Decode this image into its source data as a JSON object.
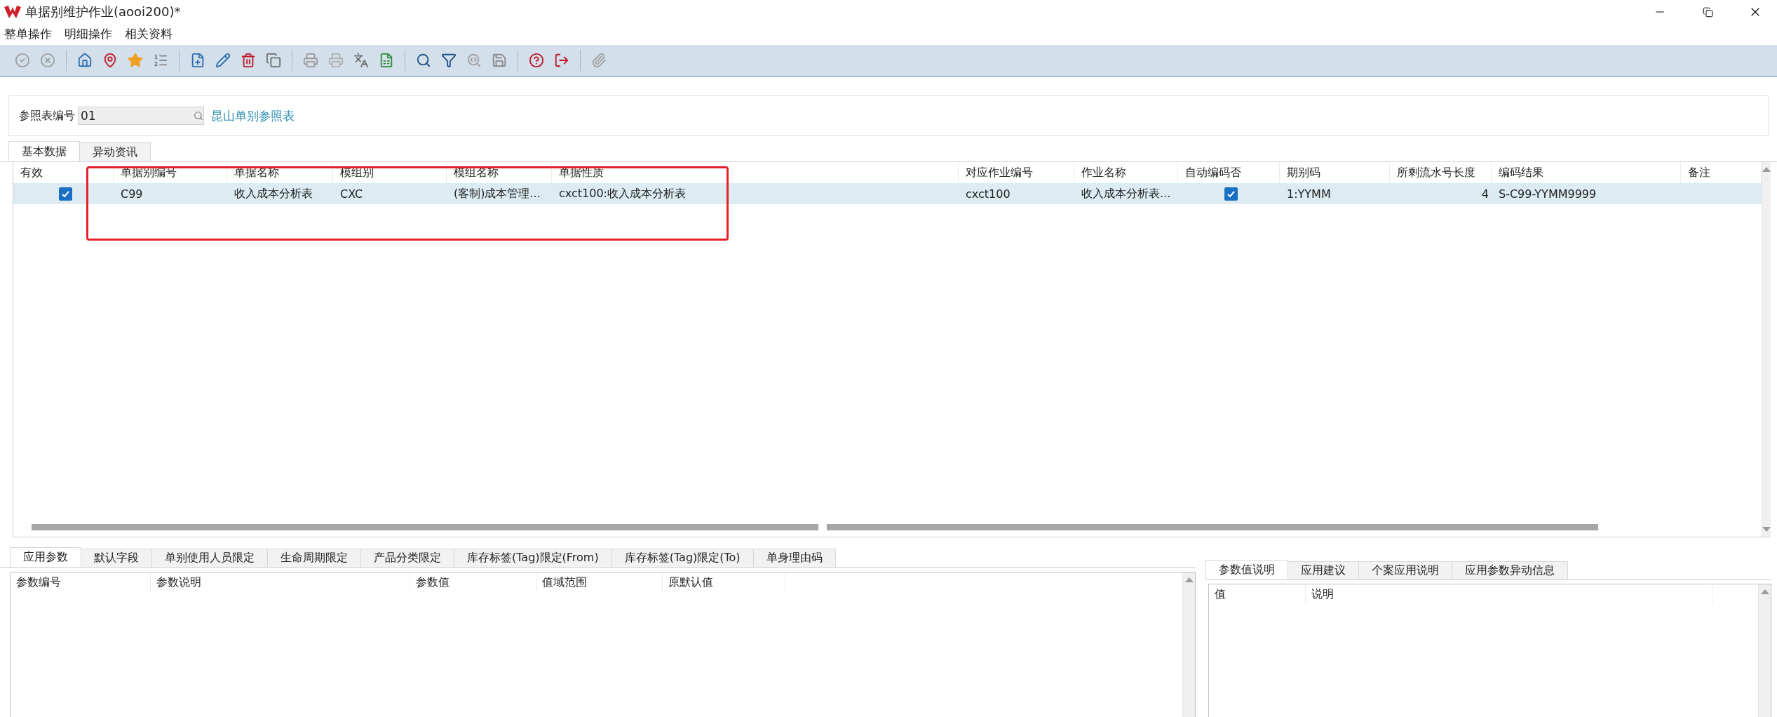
{
  "window": {
    "title": "单据别维护作业(aooi200)*"
  },
  "menu": [
    "整单操作",
    "明细操作",
    "相关资料"
  ],
  "header_form": {
    "label": "参照表编号",
    "value": "01",
    "link": "昆山单别参照表"
  },
  "top_tabs": [
    {
      "label": "基本数据",
      "selected": true
    },
    {
      "label": "异动资讯",
      "selected": false
    }
  ],
  "table": {
    "columns": [
      {
        "label": "有效",
        "kind": "check"
      },
      {
        "label": "单据别编号",
        "kind": "text"
      },
      {
        "label": "单据名称",
        "kind": "text"
      },
      {
        "label": "模组别",
        "kind": "text"
      },
      {
        "label": "模组名称",
        "kind": "text"
      },
      {
        "label": "单据性质",
        "kind": "text"
      },
      {
        "label": "对应作业编号",
        "kind": "text"
      },
      {
        "label": "作业名称",
        "kind": "text"
      },
      {
        "label": "自动编码否",
        "kind": "check"
      },
      {
        "label": "期别码",
        "kind": "text"
      },
      {
        "label": "所剩流水号长度",
        "kind": "number"
      },
      {
        "label": "编码结果",
        "kind": "text"
      },
      {
        "label": "备注",
        "kind": "text"
      }
    ],
    "rows": [
      {
        "selected": true,
        "cells": [
          {
            "checked": true
          },
          {
            "text": "C99"
          },
          {
            "text": "收入成本分析表"
          },
          {
            "text": "CXC"
          },
          {
            "text": "(客制)成本管理..."
          },
          {
            "text": "cxct100:收入成本分析表"
          },
          {
            "text": "cxct100"
          },
          {
            "text": "收入成本分析表..."
          },
          {
            "checked": true
          },
          {
            "text": "1:YYMM"
          },
          {
            "text": "4"
          },
          {
            "text": "S-C99-YYMM9999"
          },
          {}
        ]
      }
    ]
  },
  "bottom_tabs": [
    {
      "label": "应用参数",
      "selected": true
    },
    {
      "label": "默认字段",
      "selected": false
    },
    {
      "label": "单别使用人员限定",
      "selected": false
    },
    {
      "label": "生命周期限定",
      "selected": false
    },
    {
      "label": "产品分类限定",
      "selected": false
    },
    {
      "label": "库存标签(Tag)限定(From)",
      "selected": false
    },
    {
      "label": "库存标签(Tag)限定(To)",
      "selected": false
    },
    {
      "label": "单身理由码",
      "selected": false
    }
  ],
  "param_columns": [
    "参数编号",
    "参数说明",
    "参数值",
    "值域范围",
    "原默认值"
  ],
  "side_tabs": [
    {
      "label": "参数值说明",
      "selected": true
    },
    {
      "label": "应用建议",
      "selected": false
    },
    {
      "label": "个案应用说明",
      "selected": false
    },
    {
      "label": "应用参数异动信息",
      "selected": false
    }
  ],
  "side_columns": [
    "值",
    "说明"
  ]
}
